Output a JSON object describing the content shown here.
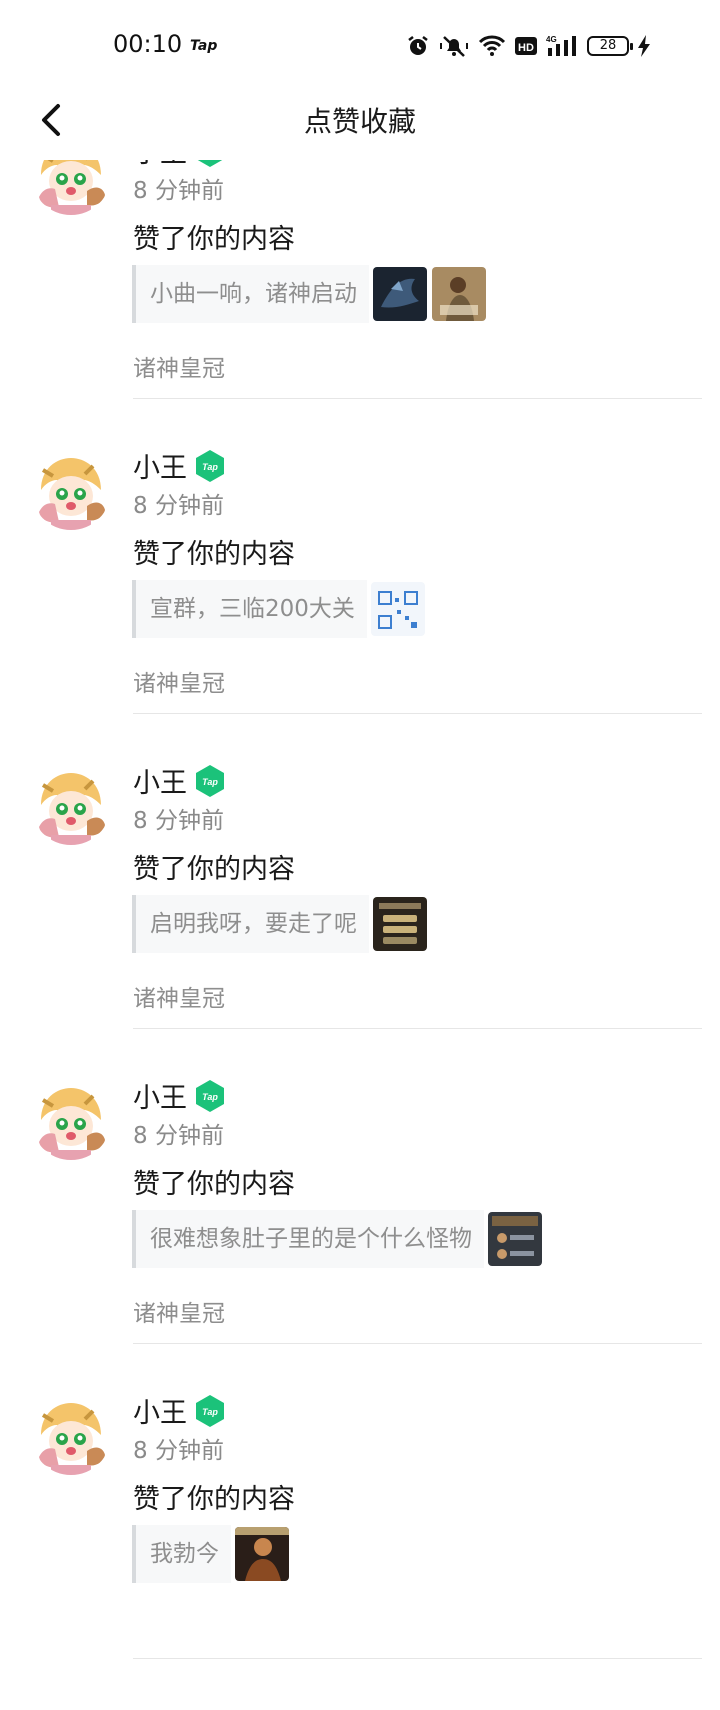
{
  "status_bar": {
    "time": "00:10",
    "app_mark": "Tap",
    "network": "4G",
    "hd": "HD",
    "battery": "28",
    "icons": [
      "alarm-icon",
      "mute-icon",
      "wifi-icon",
      "hd-icon",
      "signal-icon",
      "battery-icon",
      "charging-icon"
    ]
  },
  "header": {
    "title": "点赞收藏",
    "back_icon": "chevron-left-icon"
  },
  "badge_text": "Tap",
  "colors": {
    "badge_green": "#1bc27a",
    "divider": "#e6e6e6",
    "quote_bar": "#d7dadd"
  },
  "items": [
    {
      "user": "小王",
      "time": "8 分钟前",
      "action": "赞了你的内容",
      "quote": "小曲一响，诸神启动",
      "thumbs": [
        "dark-dragon",
        "soldier"
      ],
      "game": "诸神皇冠"
    },
    {
      "user": "小王",
      "time": "8 分钟前",
      "action": "赞了你的内容",
      "quote": "宣群，三临200大关",
      "thumbs": [
        "qr-code"
      ],
      "game": "诸神皇冠"
    },
    {
      "user": "小王",
      "time": "8 分钟前",
      "action": "赞了你的内容",
      "quote": "启明我呀，要走了呢",
      "thumbs": [
        "game-menu"
      ],
      "game": "诸神皇冠"
    },
    {
      "user": "小王",
      "time": "8 分钟前",
      "action": "赞了你的内容",
      "quote": "很难想象肚子里的是个什么怪物",
      "thumbs": [
        "game-screen"
      ],
      "game": "诸神皇冠"
    },
    {
      "user": "小王",
      "time": "8 分钟前",
      "action": "赞了你的内容",
      "quote": "我勃今",
      "thumbs": [
        "warrior"
      ],
      "game": ""
    }
  ]
}
